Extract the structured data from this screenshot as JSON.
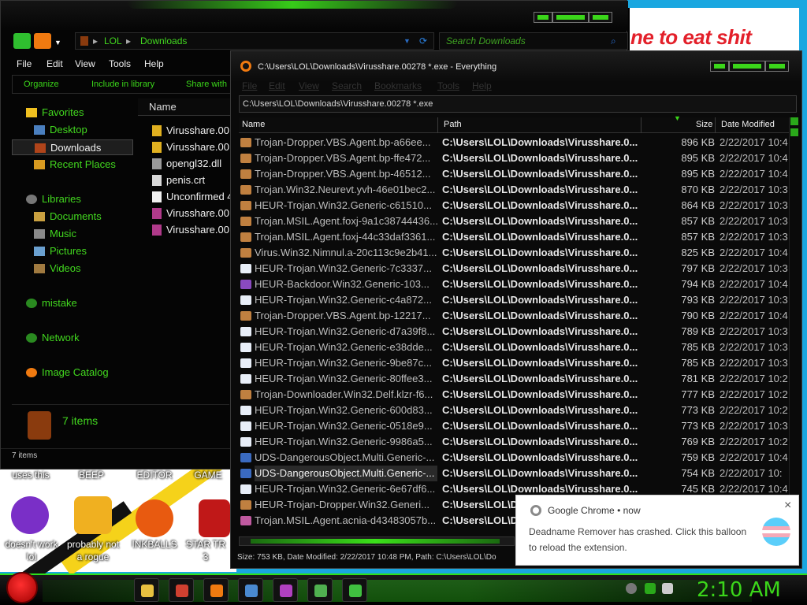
{
  "paint": {
    "text": "ne to eat shit"
  },
  "desktop": {
    "top_labels": [
      "uses this",
      "BEEP",
      "EDITOR",
      "GAME"
    ],
    "icons": [
      {
        "label_lines": [
          "doesn't work",
          "lol"
        ],
        "icon": "yahoo-messenger-icon",
        "color": "#7a2fc7"
      },
      {
        "label_lines": [
          "probably not",
          "a rogue"
        ],
        "icon": "gears-screen-icon",
        "color": "#f0b020"
      },
      {
        "label_lines": [
          "INKBALLS",
          ""
        ],
        "icon": "inkball-icon",
        "color": "#e85a10"
      },
      {
        "label_lines": [
          "STAR TR",
          "3"
        ],
        "icon": "star-wars-icon",
        "color": "#c01818"
      }
    ]
  },
  "explorer": {
    "breadcrumb": [
      "LOL",
      "Downloads"
    ],
    "search_placeholder": "Search Downloads",
    "menu": [
      "File",
      "Edit",
      "View",
      "Tools",
      "Help"
    ],
    "commands": [
      "Organize",
      "Include in library",
      "Share with"
    ],
    "nav": [
      {
        "label": "Favorites",
        "icon": "star-icon",
        "color": "#f0c020",
        "level": 0
      },
      {
        "label": "Desktop",
        "icon": "desktop-icon",
        "color": "#4a7fbf",
        "level": 1
      },
      {
        "label": "Downloads",
        "icon": "downloads-icon",
        "color": "#b0441a",
        "level": 1,
        "selected": true
      },
      {
        "label": "Recent Places",
        "icon": "recent-places-icon",
        "color": "#d89a20",
        "level": 1
      },
      {
        "label": "Libraries",
        "icon": "libraries-icon",
        "color": "#777777",
        "level": 0
      },
      {
        "label": "Documents",
        "icon": "documents-icon",
        "color": "#c9a040",
        "level": 1
      },
      {
        "label": "Music",
        "icon": "music-icon",
        "color": "#8a8a8a",
        "level": 1
      },
      {
        "label": "Pictures",
        "icon": "pictures-icon",
        "color": "#6aa0d0",
        "level": 1
      },
      {
        "label": "Videos",
        "icon": "videos-icon",
        "color": "#a07a40",
        "level": 1
      },
      {
        "label": "mistake",
        "icon": "homegroup-icon",
        "color": "#2a8a20",
        "level": 0
      },
      {
        "label": "Network",
        "icon": "network-icon",
        "color": "#2a8a20",
        "level": 0
      },
      {
        "label": "Image Catalog",
        "icon": "image-catalog-icon",
        "color": "#f07a10",
        "level": 0
      }
    ],
    "column_name": "Name",
    "files": [
      {
        "name": "Virusshare.00",
        "icon": "archive-icon",
        "color": "#e0b020"
      },
      {
        "name": "Virusshare.00",
        "icon": "archive-icon",
        "color": "#e0b020"
      },
      {
        "name": "opengl32.dll",
        "icon": "dll-icon",
        "color": "#9a9a9a"
      },
      {
        "name": "penis.crt",
        "icon": "certificate-icon",
        "color": "#d8d8d8"
      },
      {
        "name": "Unconfirmed 4",
        "icon": "blank-file-icon",
        "color": "#f0f0f0"
      },
      {
        "name": "Virusshare.00",
        "icon": "winrar-icon",
        "color": "#b03a8a"
      },
      {
        "name": "Virusshare.00",
        "icon": "winrar-icon",
        "color": "#b03a8a"
      }
    ],
    "details_count": "7 items",
    "status": "7 items"
  },
  "everything": {
    "title": "C:\\Users\\LOL\\Downloads\\Virusshare.00278 *.exe - Everything",
    "menu": [
      "File",
      "Edit",
      "View",
      "Search",
      "Bookmarks",
      "Tools",
      "Help"
    ],
    "search_value": "C:\\Users\\LOL\\Downloads\\Virusshare.00278 *.exe",
    "columns": {
      "name": "Name",
      "path": "Path",
      "size": "Size",
      "date": "Date Modified"
    },
    "path_value": "C:\\Users\\LOL\\Downloads\\Virusshare.0...",
    "rows": [
      {
        "name": "Trojan-Dropper.VBS.Agent.bp-a66ee...",
        "size": "896 KB",
        "date": "2/22/2017 10:4",
        "icon": "#c08040"
      },
      {
        "name": "Trojan-Dropper.VBS.Agent.bp-ffe472...",
        "size": "895 KB",
        "date": "2/22/2017 10:4",
        "icon": "#c08040"
      },
      {
        "name": "Trojan-Dropper.VBS.Agent.bp-46512...",
        "size": "895 KB",
        "date": "2/22/2017 10:4",
        "icon": "#c08040"
      },
      {
        "name": "Trojan.Win32.Neurevt.yvh-46e01bec2...",
        "size": "870 KB",
        "date": "2/22/2017 10:3",
        "icon": "#c08040"
      },
      {
        "name": "HEUR-Trojan.Win32.Generic-c61510...",
        "size": "864 KB",
        "date": "2/22/2017 10:3",
        "icon": "#c08040"
      },
      {
        "name": "Trojan.MSIL.Agent.foxj-9a1c38744436...",
        "size": "857 KB",
        "date": "2/22/2017 10:3",
        "icon": "#c08040"
      },
      {
        "name": "Trojan.MSIL.Agent.foxj-44c33daf3361...",
        "size": "857 KB",
        "date": "2/22/2017 10:3",
        "icon": "#c08040"
      },
      {
        "name": "Virus.Win32.Nimnul.a-20c113c9e2b41...",
        "size": "825 KB",
        "date": "2/22/2017 10:4",
        "icon": "#c08040"
      },
      {
        "name": "HEUR-Trojan.Win32.Generic-7c3337...",
        "size": "797 KB",
        "date": "2/22/2017 10:3",
        "icon": "#e8eef8"
      },
      {
        "name": "HEUR-Backdoor.Win32.Generic-103...",
        "size": "794 KB",
        "date": "2/22/2017 10:4",
        "icon": "#8a4ac0"
      },
      {
        "name": "HEUR-Trojan.Win32.Generic-c4a872...",
        "size": "793 KB",
        "date": "2/22/2017 10:3",
        "icon": "#e8eef8"
      },
      {
        "name": "Trojan-Dropper.VBS.Agent.bp-12217...",
        "size": "790 KB",
        "date": "2/22/2017 10:4",
        "icon": "#c08040"
      },
      {
        "name": "HEUR-Trojan.Win32.Generic-d7a39f8...",
        "size": "789 KB",
        "date": "2/22/2017 10:3",
        "icon": "#e8eef8"
      },
      {
        "name": "HEUR-Trojan.Win32.Generic-e38dde...",
        "size": "785 KB",
        "date": "2/22/2017 10:3",
        "icon": "#e8eef8"
      },
      {
        "name": "HEUR-Trojan.Win32.Generic-9be87c...",
        "size": "785 KB",
        "date": "2/22/2017 10:3",
        "icon": "#e8eef8"
      },
      {
        "name": "HEUR-Trojan.Win32.Generic-80ffee3...",
        "size": "781 KB",
        "date": "2/22/2017 10:2",
        "icon": "#e8eef8"
      },
      {
        "name": "Trojan-Downloader.Win32.Delf.klzr-f6...",
        "size": "777 KB",
        "date": "2/22/2017 10:2",
        "icon": "#c08040"
      },
      {
        "name": "HEUR-Trojan.Win32.Generic-600d83...",
        "size": "773 KB",
        "date": "2/22/2017 10:2",
        "icon": "#e8eef8"
      },
      {
        "name": "HEUR-Trojan.Win32.Generic-0518e9...",
        "size": "773 KB",
        "date": "2/22/2017 10:3",
        "icon": "#e8eef8"
      },
      {
        "name": "HEUR-Trojan.Win32.Generic-9986a5...",
        "size": "769 KB",
        "date": "2/22/2017 10:2",
        "icon": "#e8eef8"
      },
      {
        "name": "UDS-DangerousObject.Multi.Generic-...",
        "size": "759 KB",
        "date": "2/22/2017 10:4",
        "icon": "#3a6ac0"
      },
      {
        "name": "UDS-DangerousObject.Multi.Generic-...",
        "size": "754 KB",
        "date": "2/22/2017 10:",
        "icon": "#3a6ac0",
        "highlight": true
      },
      {
        "name": "HEUR-Trojan.Win32.Generic-6e67df6...",
        "size": "745 KB",
        "date": "2/22/2017 10:4",
        "icon": "#e8eef8"
      },
      {
        "name": "HEUR-Trojan-Dropper.Win32.Generi...",
        "size": "",
        "date": "",
        "icon": "#c08040"
      },
      {
        "name": "Trojan.MSIL.Agent.acnia-d43483057b...",
        "size": "",
        "date": "",
        "icon": "#c05aa0"
      }
    ],
    "status": "Size: 753 KB, Date Modified: 2/22/2017 10:48 PM, Path: C:\\Users\\LOL\\Do"
  },
  "notification": {
    "app": "Google Chrome",
    "time": "now",
    "message": "Deadname Remover has crashed. Click this balloon to reload the extension.",
    "close": "×"
  },
  "taskbar": {
    "buttons": [
      {
        "icon": "file-explorer-icon",
        "color": "#e8c040"
      },
      {
        "icon": "chrome-icon",
        "color": "#d04030"
      },
      {
        "icon": "everything-search-icon",
        "color": "#f07a10"
      },
      {
        "icon": "control-panel-icon",
        "color": "#4a8ad0"
      },
      {
        "icon": "purple-app-icon",
        "color": "#b040c0"
      },
      {
        "icon": "paint-icon",
        "color": "#50b050"
      },
      {
        "icon": "green-app-icon",
        "color": "#40c040"
      }
    ],
    "clock": "2:10 AM"
  }
}
